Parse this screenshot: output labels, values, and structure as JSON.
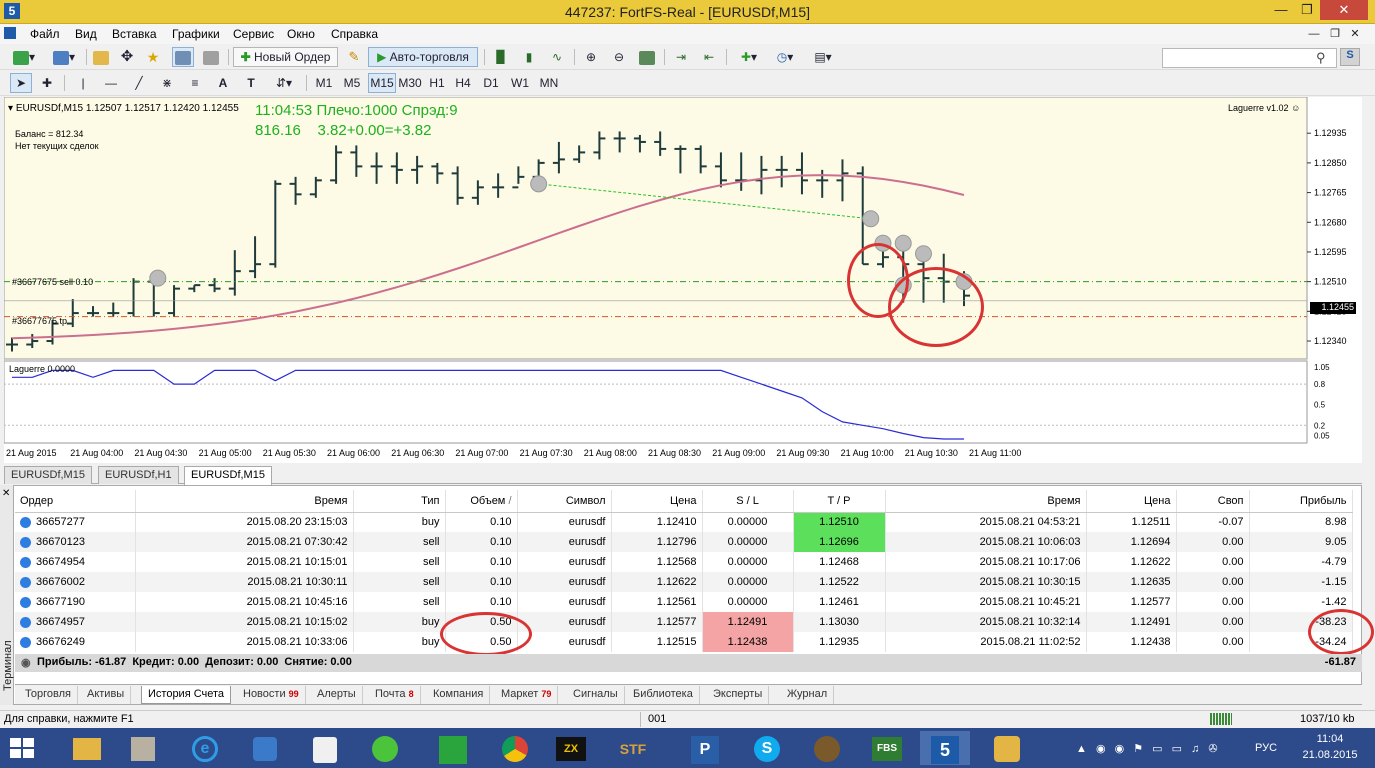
{
  "window": {
    "title": "447237: FortFS-Real - [EURUSDf,M15]"
  },
  "menu": [
    "Файл",
    "Вид",
    "Вставка",
    "Графики",
    "Сервис",
    "Окно",
    "Справка"
  ],
  "toolbar": {
    "new_order": "Новый Ордер",
    "auto_trade": "Авто-торговля"
  },
  "timeframes": [
    "M1",
    "M5",
    "M15",
    "M30",
    "H1",
    "H4",
    "D1",
    "W1",
    "MN"
  ],
  "timeframe_selected": "M15",
  "chart": {
    "header": "EURUSDf,M15  1.12507 1.12517 1.12420 1.12455",
    "info_line1": "11:04:53 Плечо:1000 Спрэд:9",
    "info_line2": "816.16    3.82+0.00=+3.82",
    "balance": "Баланс = 812.34",
    "no_trades": "Нет текущих сделок",
    "indicator_name": "Laguerre v1.02",
    "order_line_sell": "#36677675 sell 0.10",
    "order_line_tp": "#36677675 tp",
    "current_price": "1.12455",
    "sub_label": "Laguerre 0.0000",
    "price_ticks": [
      "1.12935",
      "1.12850",
      "1.12765",
      "1.12680",
      "1.12595",
      "1.12510",
      "1.12425",
      "1.12340"
    ],
    "sub_ticks": [
      "1.05",
      "0.8",
      "0.5",
      "0.2",
      "0.05"
    ],
    "time_ticks": [
      "21 Aug 2015",
      "21 Aug 04:00",
      "21 Aug 04:30",
      "21 Aug 05:00",
      "21 Aug 05:30",
      "21 Aug 06:00",
      "21 Aug 06:30",
      "21 Aug 07:00",
      "21 Aug 07:30",
      "21 Aug 08:00",
      "21 Aug 08:30",
      "21 Aug 09:00",
      "21 Aug 09:30",
      "21 Aug 10:00",
      "21 Aug 10:30",
      "21 Aug 11:00"
    ],
    "colors": {
      "bg": "#fdfbe6",
      "bar": "#1f3b3b",
      "ma": "#cc6f8e",
      "lag": "#2b2bd6",
      "ask": "#2a9a2a",
      "tp": "#d4542a"
    }
  },
  "chart_data": {
    "type": "ohlc",
    "title": "EURUSDf,M15",
    "ylim": [
      1.123,
      1.1301
    ],
    "bars": [
      [
        1.1233,
        1.1235,
        1.1231,
        1.1233
      ],
      [
        1.1233,
        1.1236,
        1.1232,
        1.1234
      ],
      [
        1.1234,
        1.124,
        1.1233,
        1.1239
      ],
      [
        1.1239,
        1.1246,
        1.1238,
        1.1242
      ],
      [
        1.1242,
        1.1244,
        1.1241,
        1.1242
      ],
      [
        1.1242,
        1.1245,
        1.1241,
        1.1242
      ],
      [
        1.1242,
        1.1252,
        1.1241,
        1.1251
      ],
      [
        1.1251,
        1.1252,
        1.1241,
        1.1242
      ],
      [
        1.1242,
        1.125,
        1.1241,
        1.1249
      ],
      [
        1.1249,
        1.125,
        1.1248,
        1.125
      ],
      [
        1.125,
        1.1252,
        1.1248,
        1.1249
      ],
      [
        1.1249,
        1.126,
        1.1247,
        1.1254
      ],
      [
        1.1254,
        1.1264,
        1.1252,
        1.1256
      ],
      [
        1.1256,
        1.128,
        1.1255,
        1.1279
      ],
      [
        1.1279,
        1.1281,
        1.1273,
        1.1276
      ],
      [
        1.1276,
        1.1281,
        1.1275,
        1.128
      ],
      [
        1.128,
        1.129,
        1.1279,
        1.1288
      ],
      [
        1.1288,
        1.129,
        1.1281,
        1.1284
      ],
      [
        1.1284,
        1.1288,
        1.1279,
        1.1284
      ],
      [
        1.1284,
        1.1288,
        1.1279,
        1.1283
      ],
      [
        1.1283,
        1.1287,
        1.1279,
        1.1284
      ],
      [
        1.1284,
        1.1285,
        1.1279,
        1.1282
      ],
      [
        1.1282,
        1.1284,
        1.1273,
        1.1275
      ],
      [
        1.1275,
        1.128,
        1.1273,
        1.1278
      ],
      [
        1.1278,
        1.1282,
        1.1275,
        1.1278
      ],
      [
        1.1278,
        1.1284,
        1.1279,
        1.1281
      ],
      [
        1.1281,
        1.1286,
        1.1279,
        1.1285
      ],
      [
        1.1285,
        1.1291,
        1.1282,
        1.1286
      ],
      [
        1.1286,
        1.129,
        1.1285,
        1.1288
      ],
      [
        1.1288,
        1.1294,
        1.1286,
        1.1292
      ],
      [
        1.1292,
        1.1294,
        1.1288,
        1.1292
      ],
      [
        1.1292,
        1.1293,
        1.1288,
        1.1291
      ],
      [
        1.1291,
        1.1294,
        1.1287,
        1.1289
      ],
      [
        1.1289,
        1.129,
        1.1282,
        1.1289
      ],
      [
        1.1289,
        1.129,
        1.1282,
        1.1284
      ],
      [
        1.1284,
        1.1288,
        1.1278,
        1.128
      ],
      [
        1.128,
        1.1288,
        1.1277,
        1.128
      ],
      [
        1.128,
        1.1287,
        1.1276,
        1.1283
      ],
      [
        1.1283,
        1.1287,
        1.1278,
        1.1283
      ],
      [
        1.1283,
        1.1288,
        1.1276,
        1.128
      ],
      [
        1.128,
        1.1283,
        1.1275,
        1.128
      ],
      [
        1.128,
        1.1286,
        1.1274,
        1.1282
      ],
      [
        1.1282,
        1.1284,
        1.1256,
        1.1256
      ],
      [
        1.1256,
        1.1262,
        1.1255,
        1.1258
      ],
      [
        1.1258,
        1.1264,
        1.1245,
        1.1256
      ],
      [
        1.1256,
        1.1258,
        1.1245,
        1.1252
      ],
      [
        1.1252,
        1.1259,
        1.1245,
        1.1251
      ],
      [
        1.1251,
        1.1254,
        1.1244,
        1.1247
      ]
    ],
    "ma_from": 1.1234,
    "ma_peak": 1.12815,
    "laguerre": [
      0.9,
      0.9,
      1.0,
      1.0,
      0.9,
      1.0,
      1.0,
      1.0,
      0.8,
      0.8,
      1.0,
      1.0,
      1.0,
      0.85,
      1.0,
      1.0,
      1.0,
      1.0,
      1.0,
      1.0,
      1.0,
      1.0,
      1.0,
      1.0,
      1.0,
      1.0,
      1.0,
      1.0,
      1.0,
      1.0,
      1.0,
      1.0,
      1.0,
      1.0,
      1.0,
      1.0,
      0.9,
      0.8,
      0.7,
      0.6,
      0.4,
      0.25,
      0.2,
      0.15,
      0.08,
      0.02,
      0.0,
      0.0
    ]
  },
  "tabs": [
    "EURUSDf,M15",
    "EURUSDf,H1",
    "EURUSDf,M15"
  ],
  "terminal": {
    "side_label": "Терминал",
    "columns": [
      "Ордер",
      "Время",
      "Тип",
      "Объем",
      "Символ",
      "Цена",
      "S / L",
      "T / P",
      "Время",
      "Цена",
      "Своп",
      "Прибыль"
    ],
    "sort_mark": "/",
    "rows": [
      [
        "36657277",
        "2015.08.20 23:15:03",
        "buy",
        "0.10",
        "eurusdf",
        "1.12410",
        "0.00000",
        "1.12510",
        "2015.08.21 04:53:21",
        "1.12511",
        "-0.07",
        "8.98"
      ],
      [
        "36670123",
        "2015.08.21 07:30:42",
        "sell",
        "0.10",
        "eurusdf",
        "1.12796",
        "0.00000",
        "1.12696",
        "2015.08.21 10:06:03",
        "1.12694",
        "0.00",
        "9.05"
      ],
      [
        "36674954",
        "2015.08.21 10:15:01",
        "sell",
        "0.10",
        "eurusdf",
        "1.12568",
        "0.00000",
        "1.12468",
        "2015.08.21 10:17:06",
        "1.12622",
        "0.00",
        "-4.79"
      ],
      [
        "36676002",
        "2015.08.21 10:30:11",
        "sell",
        "0.10",
        "eurusdf",
        "1.12622",
        "0.00000",
        "1.12522",
        "2015.08.21 10:30:15",
        "1.12635",
        "0.00",
        "-1.15"
      ],
      [
        "36677190",
        "2015.08.21 10:45:16",
        "sell",
        "0.10",
        "eurusdf",
        "1.12561",
        "0.00000",
        "1.12461",
        "2015.08.21 10:45:21",
        "1.12577",
        "0.00",
        "-1.42"
      ],
      [
        "36674957",
        "2015.08.21 10:15:02",
        "buy",
        "0.50",
        "eurusdf",
        "1.12577",
        "1.12491",
        "1.13030",
        "2015.08.21 10:32:14",
        "1.12491",
        "0.00",
        "-38.23"
      ],
      [
        "36676249",
        "2015.08.21 10:33:06",
        "buy",
        "0.50",
        "eurusdf",
        "1.12515",
        "1.12438",
        "1.12935",
        "2015.08.21 11:02:52",
        "1.12438",
        "0.00",
        "-34.24"
      ]
    ],
    "summary": "Прибыль: -61.87  Кредит: 0.00  Депозит: 0.00  Снятие: 0.00",
    "summary_total": "-61.87",
    "bottom_tabs": [
      {
        "label": "Торговля",
        "count": ""
      },
      {
        "label": "Активы",
        "count": ""
      },
      {
        "label": "История Счета",
        "count": ""
      },
      {
        "label": "Новости",
        "count": "99"
      },
      {
        "label": "Алерты",
        "count": ""
      },
      {
        "label": "Почта",
        "count": "8"
      },
      {
        "label": "Компания",
        "count": ""
      },
      {
        "label": "Маркет",
        "count": "79"
      },
      {
        "label": "Сигналы",
        "count": ""
      },
      {
        "label": "Библиотека",
        "count": ""
      },
      {
        "label": "Эксперты",
        "count": ""
      },
      {
        "label": "Журнал",
        "count": ""
      }
    ]
  },
  "status": {
    "help": "Для справки, нажмите F1",
    "profile": "001",
    "traffic": "1037/10 kb"
  },
  "taskbar": {
    "lang": "РУС",
    "time": "11:04",
    "date": "21.08.2015"
  }
}
